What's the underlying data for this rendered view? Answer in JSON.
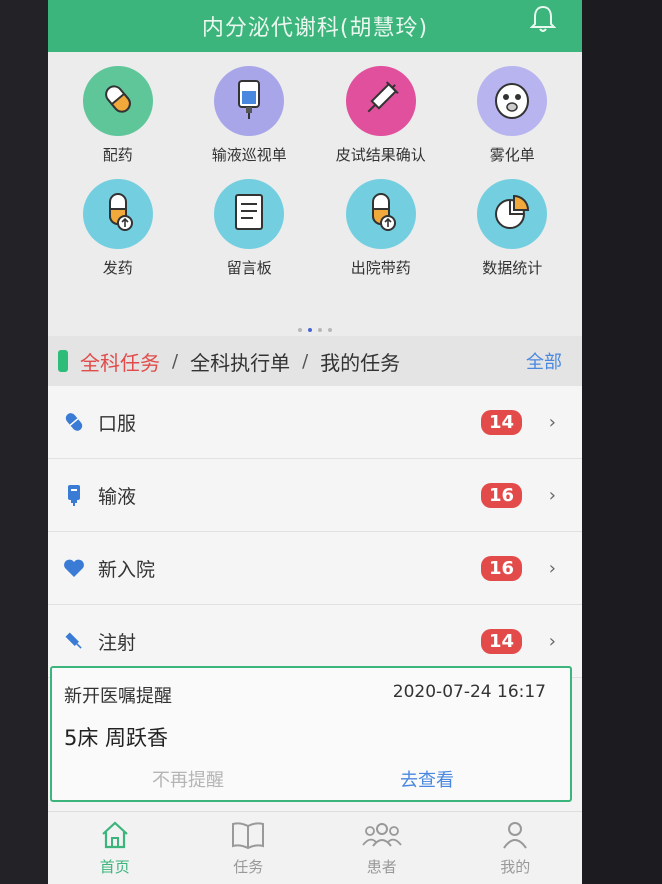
{
  "header": {
    "title": "内分泌代谢科(胡慧玲)"
  },
  "grid": {
    "row1": [
      {
        "label": "配药",
        "icon": "capsule-icon"
      },
      {
        "label": "输液巡视单",
        "icon": "iv-bag-icon"
      },
      {
        "label": "皮试结果确认",
        "icon": "syringe-icon"
      },
      {
        "label": "雾化单",
        "icon": "nebulizer-icon"
      }
    ],
    "row2": [
      {
        "label": "发药",
        "icon": "dispense-icon"
      },
      {
        "label": "留言板",
        "icon": "notes-icon"
      },
      {
        "label": "出院带药",
        "icon": "discharge-meds-icon"
      },
      {
        "label": "数据统计",
        "icon": "pie-chart-icon"
      }
    ]
  },
  "tasks": {
    "tabs": [
      "全科任务",
      "全科执行单",
      "我的任务"
    ],
    "sep": "/",
    "all_label": "全部"
  },
  "list": [
    {
      "label": "口服",
      "count": "14",
      "icon": "pill-icon"
    },
    {
      "label": "输液",
      "count": "16",
      "icon": "infusion-icon"
    },
    {
      "label": "新入院",
      "count": "16",
      "icon": "heart-icon"
    },
    {
      "label": "注射",
      "count": "14",
      "icon": "injection-icon"
    }
  ],
  "popup": {
    "title": "新开医嘱提醒",
    "time": "2020-07-24 16:17",
    "patient": "5床 周跃香",
    "dismiss": "不再提醒",
    "view": "去查看"
  },
  "nav": [
    {
      "label": "首页",
      "icon": "home-icon"
    },
    {
      "label": "任务",
      "icon": "book-icon"
    },
    {
      "label": "患者",
      "icon": "patients-icon"
    },
    {
      "label": "我的",
      "icon": "user-icon"
    }
  ],
  "colors": {
    "brand": "#3bb57c",
    "badge": "#e34a4a",
    "link": "#4a88e0",
    "active_tab": "#e24b4b"
  }
}
